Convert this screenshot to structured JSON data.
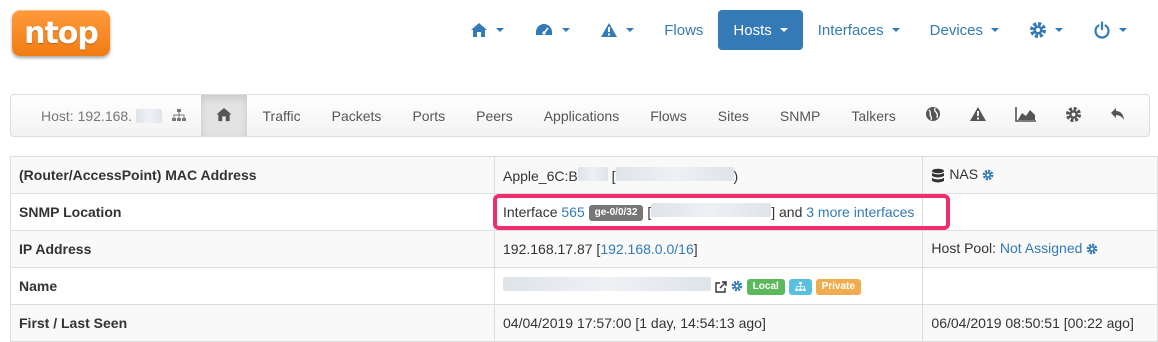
{
  "logo": {
    "text": "ntop"
  },
  "topnav": {
    "home_icon": "home-icon",
    "dashboard_icon": "dashboard-icon",
    "alerts_icon": "warning-icon",
    "flows": "Flows",
    "hosts": "Hosts",
    "interfaces": "Interfaces",
    "devices": "Devices",
    "settings_icon": "gear-icon",
    "power_icon": "power-icon",
    "active_color": "#337ab7"
  },
  "subnav": {
    "host_label": "Host: 192.168.",
    "tabs": [
      "Traffic",
      "Packets",
      "Ports",
      "Peers",
      "Applications",
      "Flows",
      "Sites",
      "SNMP",
      "Talkers"
    ]
  },
  "table": {
    "mac": {
      "label": "(Router/AccessPoint) MAC Address",
      "value_prefix": "Apple_6C:B",
      "value_mid": "[",
      "value_suffix": ")",
      "nas": "NAS"
    },
    "snmp": {
      "label": "SNMP Location",
      "iface_prefix": "Interface",
      "iface_link": "565",
      "iface_badge": "ge-0/0/32",
      "bracket_open": "[",
      "bracket_close": "]",
      "and": "and",
      "more_link": "3 more interfaces"
    },
    "ip": {
      "label": "IP Address",
      "value": "192.168.17.87",
      "network": "192.168.0.0/16",
      "bracket_open": "[",
      "bracket_close": "]",
      "pool_label": "Host Pool:",
      "pool_value": "Not Assigned"
    },
    "name": {
      "label": "Name",
      "badges": [
        "Local",
        "Private"
      ]
    },
    "seen": {
      "label": "First / Last Seen",
      "first": "04/04/2019 17:57:00 [1 day, 14:54:13 ago]",
      "last": "06/04/2019 08:50:51 [00:22 ago]"
    }
  }
}
